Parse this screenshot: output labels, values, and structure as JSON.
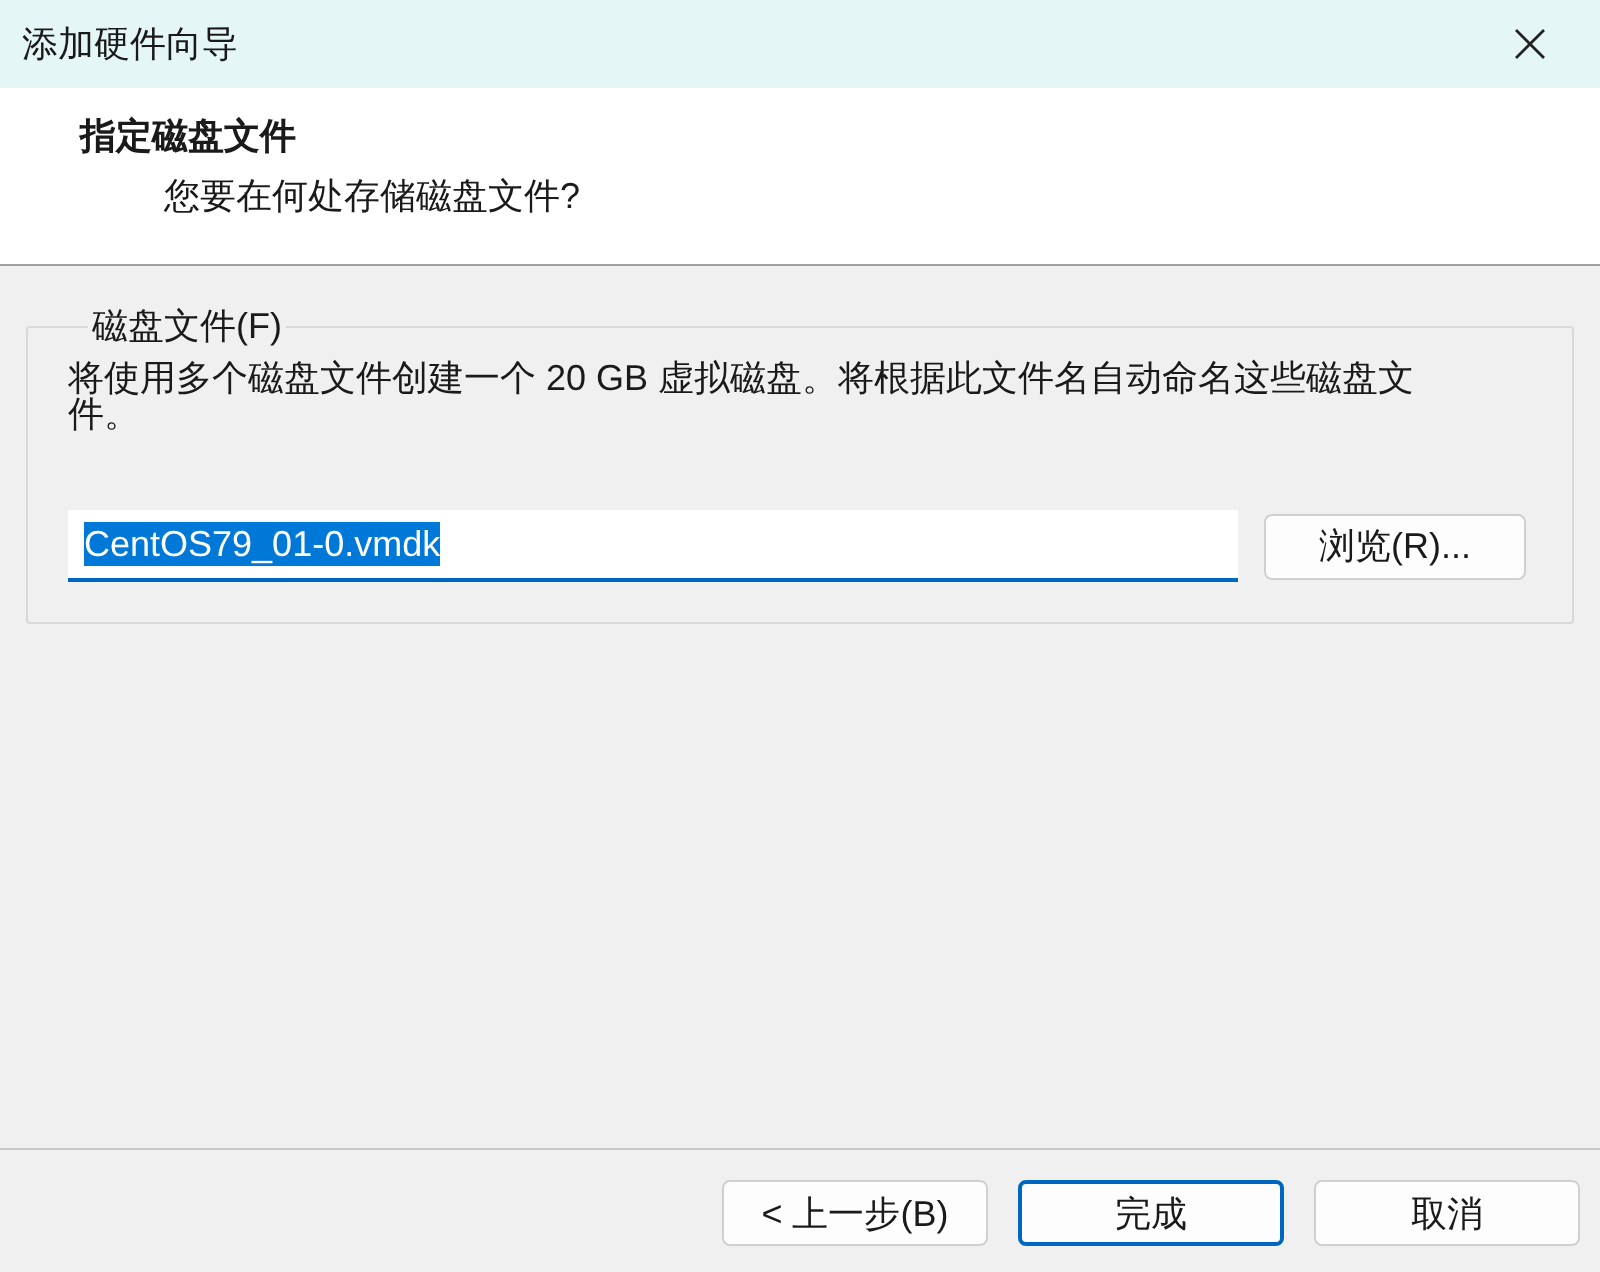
{
  "window": {
    "title": "添加硬件向导"
  },
  "header": {
    "title": "指定磁盘文件",
    "subtitle": "您要在何处存储磁盘文件?"
  },
  "disk_file_group": {
    "label": "磁盘文件(F)",
    "description": "将使用多个磁盘文件创建一个 20 GB 虚拟磁盘。将根据此文件名自动命名这些磁盘文件。",
    "file_field": {
      "value": "CentOS79_01-0.vmdk",
      "value_selected": true,
      "focused": true
    },
    "browse_button": "浏览(R)..."
  },
  "buttons": [
    {
      "label": "< 上一步(B)",
      "default": false
    },
    {
      "label": "完成",
      "default": true
    },
    {
      "label": "取消",
      "default": false
    }
  ]
}
